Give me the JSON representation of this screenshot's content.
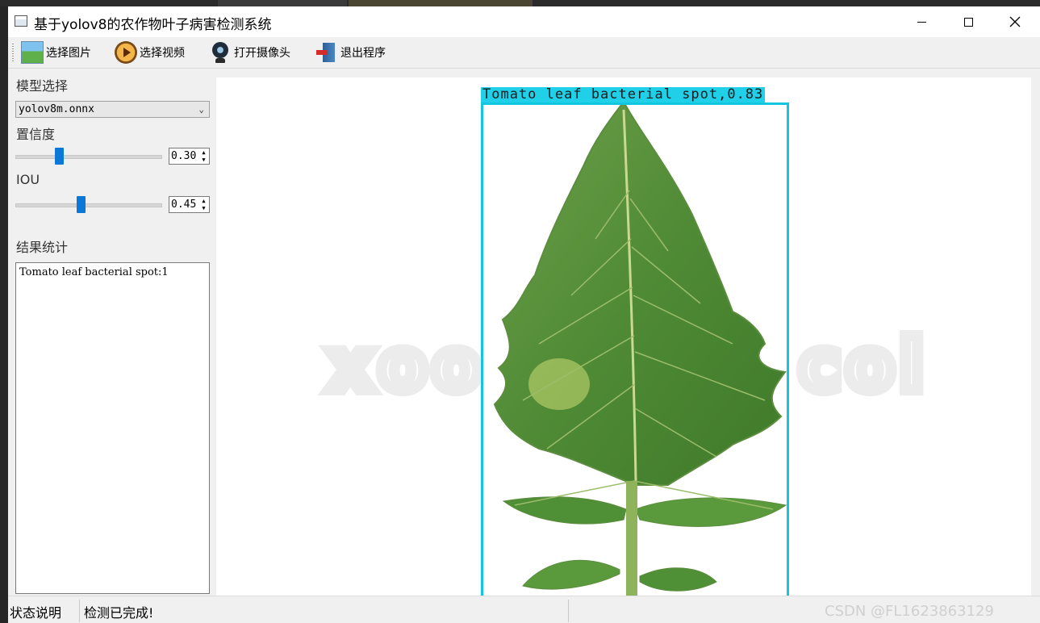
{
  "window": {
    "title": "基于yolov8的农作物叶子病害检测系统"
  },
  "toolbar": {
    "items": [
      {
        "label": "选择图片",
        "icon": "picture-icon"
      },
      {
        "label": "选择视频",
        "icon": "video-play-icon"
      },
      {
        "label": "打开摄像头",
        "icon": "webcam-icon"
      },
      {
        "label": "退出程序",
        "icon": "exit-door-icon"
      }
    ]
  },
  "sidebar": {
    "model_label": "模型选择",
    "model_value": "yolov8m.onnx",
    "confidence_label": "置信度",
    "confidence_value": "0.30",
    "confidence_level": 0.3,
    "iou_label": "IOU",
    "iou_value": "0.45",
    "iou_level": 0.45,
    "results_label": "结果统计",
    "results_text": "Tomato leaf bacterial spot:1"
  },
  "detection": {
    "label": "Tomato leaf bacterial spot,0.83",
    "box_color": "#12c6e0"
  },
  "background": {
    "watermark_left": "xoo",
    "watermark_right": "col"
  },
  "status": {
    "label": "状态说明",
    "message": "检测已完成!",
    "watermark": "CSDN @FL1623863129"
  },
  "colors": {
    "accent": "#0b78d7",
    "label_bg": "#1fd0e8"
  }
}
